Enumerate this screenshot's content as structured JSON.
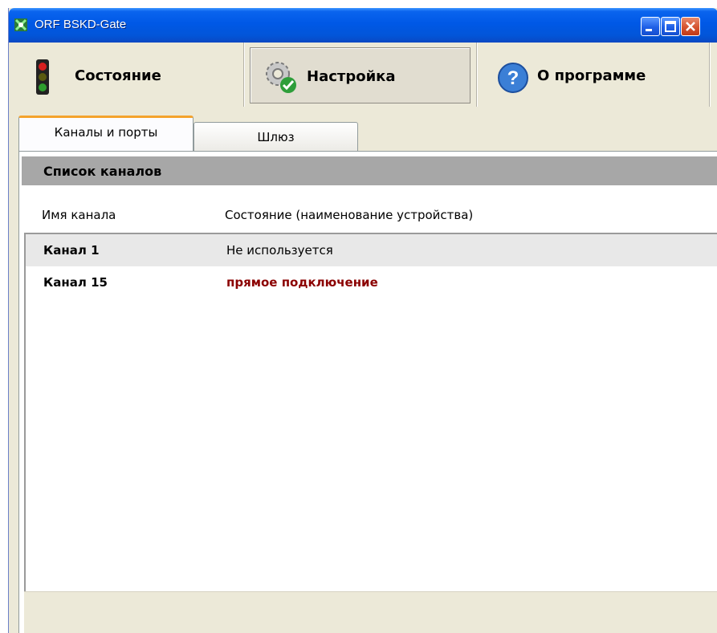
{
  "window": {
    "title": "ORF BSKD-Gate",
    "accent": "#0058e6"
  },
  "caption_buttons": {
    "minimize_icon": "minimize-icon",
    "maximize_icon": "maximize-icon",
    "close_icon": "close-icon"
  },
  "toolbar": {
    "items": [
      {
        "label": "Состояние",
        "icon": "traffic-light-icon",
        "active": false
      },
      {
        "label": "Настройка",
        "icon": "gears-check-icon",
        "active": true
      },
      {
        "label": "О программе",
        "icon": "help-icon",
        "active": false
      }
    ]
  },
  "tabs": [
    {
      "label": "Каналы и порты",
      "selected": true
    },
    {
      "label": "Шлюз",
      "selected": false
    }
  ],
  "channels": {
    "section_title": "Список каналов",
    "columns": [
      "Имя канала",
      "Состояние (наименование устройства)"
    ],
    "rows": [
      {
        "name": "Канал 1",
        "state": "Не используется",
        "selected": true
      },
      {
        "name": "Канал 15",
        "state": "прямое подключение",
        "state_color": "#8b0000"
      }
    ]
  }
}
